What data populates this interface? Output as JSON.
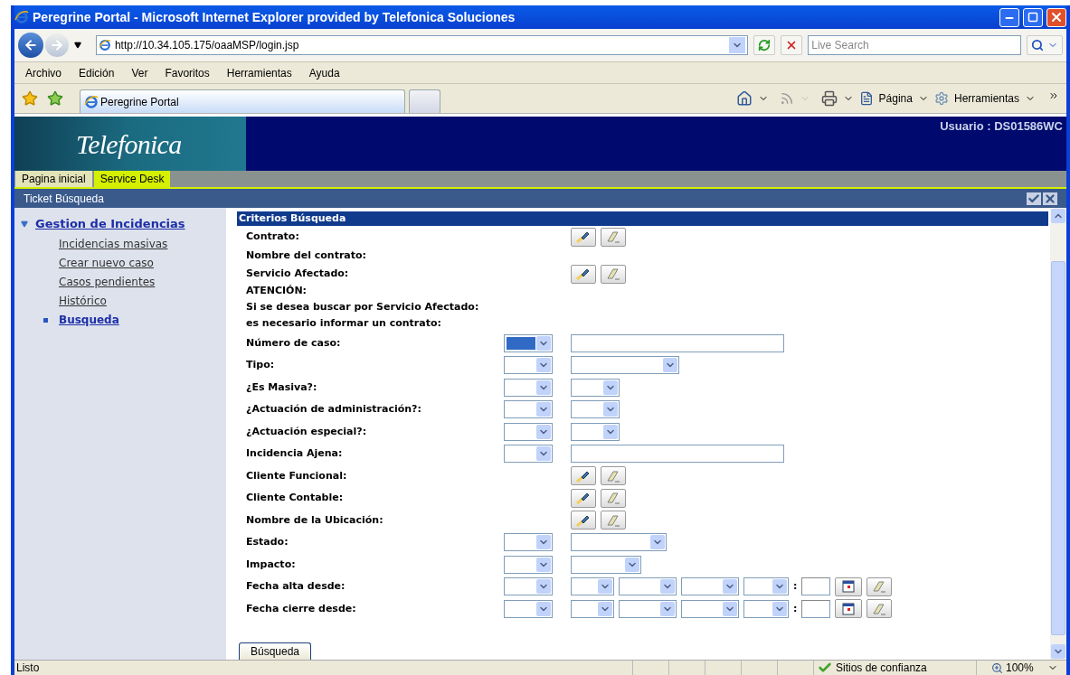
{
  "window": {
    "title": "Peregrine Portal - Microsoft Internet Explorer provided by Telefonica Soluciones"
  },
  "address_bar": {
    "value": "http://10.34.105.175/oaaMSP/login.jsp"
  },
  "search": {
    "placeholder": "Live Search"
  },
  "menu": [
    "Archivo",
    "Edición",
    "Ver",
    "Favoritos",
    "Herramientas",
    "Ayuda"
  ],
  "browser_tabs": [
    {
      "kind": "page",
      "label": "Peregrine Portal",
      "selected": true
    },
    {
      "kind": "new",
      "selected": false
    }
  ],
  "command_bar": [
    {
      "label": "Página"
    },
    {
      "label": "Herramientas"
    }
  ],
  "page": {
    "logo": "Telefonica",
    "user": "Usuario : DS01586WC",
    "portal_tabs": [
      {
        "label": "Pagina inicial",
        "selected": false
      },
      {
        "label": "Service Desk",
        "selected": true
      }
    ],
    "breadcrumb": "Ticket Búsqueda"
  },
  "sidebar": {
    "section": {
      "label": "Gestion de Incidencias",
      "expanded": true,
      "children": [
        {
          "label": "Incidencias masivas",
          "selected": false
        },
        {
          "label": "Crear nuevo caso",
          "selected": false
        },
        {
          "label": "Casos pendientes",
          "selected": false
        },
        {
          "label": "Histórico",
          "selected": false
        },
        {
          "label": "Busqueda",
          "selected": true
        }
      ]
    }
  },
  "form": {
    "title": "Criterios Búsqueda",
    "rows": [
      {
        "kind": "field",
        "label": "Contrato:",
        "column_1": [],
        "column_2": [
          {
            "kind": "lookup"
          },
          {
            "kind": "clear"
          }
        ]
      },
      {
        "kind": "field",
        "label": "Nombre del contrato:",
        "column_1": [],
        "column_2": []
      },
      {
        "kind": "field",
        "label": "Servicio Afectado:",
        "column_1": [],
        "column_2": [
          {
            "kind": "lookup"
          },
          {
            "kind": "clear"
          }
        ]
      },
      {
        "kind": "note",
        "label": "ATENCIÓN:"
      },
      {
        "kind": "note",
        "label": "Si se desea buscar por Servicio Afectado:"
      },
      {
        "kind": "note",
        "label": "es necesario informar un contrato:"
      },
      {
        "kind": "field",
        "label": "Número de caso:",
        "column_1": [
          {
            "kind": "select_sm",
            "highlighted": true
          }
        ],
        "column_2": [
          {
            "kind": "text"
          }
        ]
      },
      {
        "kind": "field",
        "label": "Tipo:",
        "column_1": [
          {
            "kind": "select_sm",
            "highlighted": false
          }
        ],
        "column_2": [
          {
            "kind": "select_xxl",
            "highlighted": false
          }
        ]
      },
      {
        "kind": "field",
        "label": "¿Es Masiva?:",
        "column_1": [
          {
            "kind": "select_sm",
            "highlighted": false
          }
        ],
        "column_2": [
          {
            "kind": "select_sm",
            "highlighted": false
          }
        ]
      },
      {
        "kind": "field",
        "label": "¿Actuación de administración?:",
        "column_1": [
          {
            "kind": "select_sm",
            "highlighted": false
          }
        ],
        "column_2": [
          {
            "kind": "select_sm",
            "highlighted": false
          }
        ]
      },
      {
        "kind": "field",
        "label": "¿Actuación especial?:",
        "column_1": [
          {
            "kind": "select_sm",
            "highlighted": false
          }
        ],
        "column_2": [
          {
            "kind": "select_sm",
            "highlighted": false
          }
        ]
      },
      {
        "kind": "field",
        "label": "Incidencia Ajena:",
        "column_1": [
          {
            "kind": "select_sm",
            "highlighted": false
          }
        ],
        "column_2": [
          {
            "kind": "text"
          }
        ]
      },
      {
        "kind": "field",
        "label": "Cliente Funcional:",
        "column_1": [],
        "column_2": [
          {
            "kind": "lookup"
          },
          {
            "kind": "clear"
          }
        ]
      },
      {
        "kind": "field",
        "label": "Cliente Contable:",
        "column_1": [],
        "column_2": [
          {
            "kind": "lookup"
          },
          {
            "kind": "clear"
          }
        ]
      },
      {
        "kind": "field",
        "label": "Nombre de la Ubicación:",
        "column_1": [],
        "column_2": [
          {
            "kind": "lookup"
          },
          {
            "kind": "clear"
          }
        ]
      },
      {
        "kind": "field",
        "label": "Estado:",
        "column_1": [
          {
            "kind": "select_sm",
            "highlighted": false
          }
        ],
        "column_2": [
          {
            "kind": "select_xl",
            "highlighted": false
          }
        ]
      },
      {
        "kind": "field",
        "label": "Impacto:",
        "column_1": [
          {
            "kind": "select_sm",
            "highlighted": false
          }
        ],
        "column_2": [
          {
            "kind": "select_lg",
            "highlighted": false
          }
        ]
      },
      {
        "kind": "field",
        "label": "Fecha alta desde:",
        "column_1": [
          {
            "kind": "select_sm",
            "highlighted": false
          }
        ],
        "column_2": [
          {
            "kind": "select_xs",
            "highlighted": false
          },
          {
            "kind": "select_md",
            "highlighted": false
          },
          {
            "kind": "select_md",
            "highlighted": false
          },
          {
            "kind": "select_sx",
            "highlighted": false
          },
          {
            "kind": "separator",
            "text": ":"
          },
          {
            "kind": "time"
          },
          {
            "kind": "calendar"
          },
          {
            "kind": "clear"
          }
        ]
      },
      {
        "kind": "field",
        "label": "Fecha cierre desde:",
        "column_1": [
          {
            "kind": "select_sm",
            "highlighted": false
          }
        ],
        "column_2": [
          {
            "kind": "select_xs",
            "highlighted": false
          },
          {
            "kind": "select_md",
            "highlighted": false
          },
          {
            "kind": "select_md",
            "highlighted": false
          },
          {
            "kind": "select_sx",
            "highlighted": false
          },
          {
            "kind": "separator",
            "text": ":"
          },
          {
            "kind": "time"
          },
          {
            "kind": "calendar"
          },
          {
            "kind": "clear"
          }
        ]
      }
    ],
    "submit": "Búsqueda"
  },
  "status_bar": {
    "text": "Listo",
    "zone": "Sitios de confianza",
    "zoom": "100%"
  }
}
